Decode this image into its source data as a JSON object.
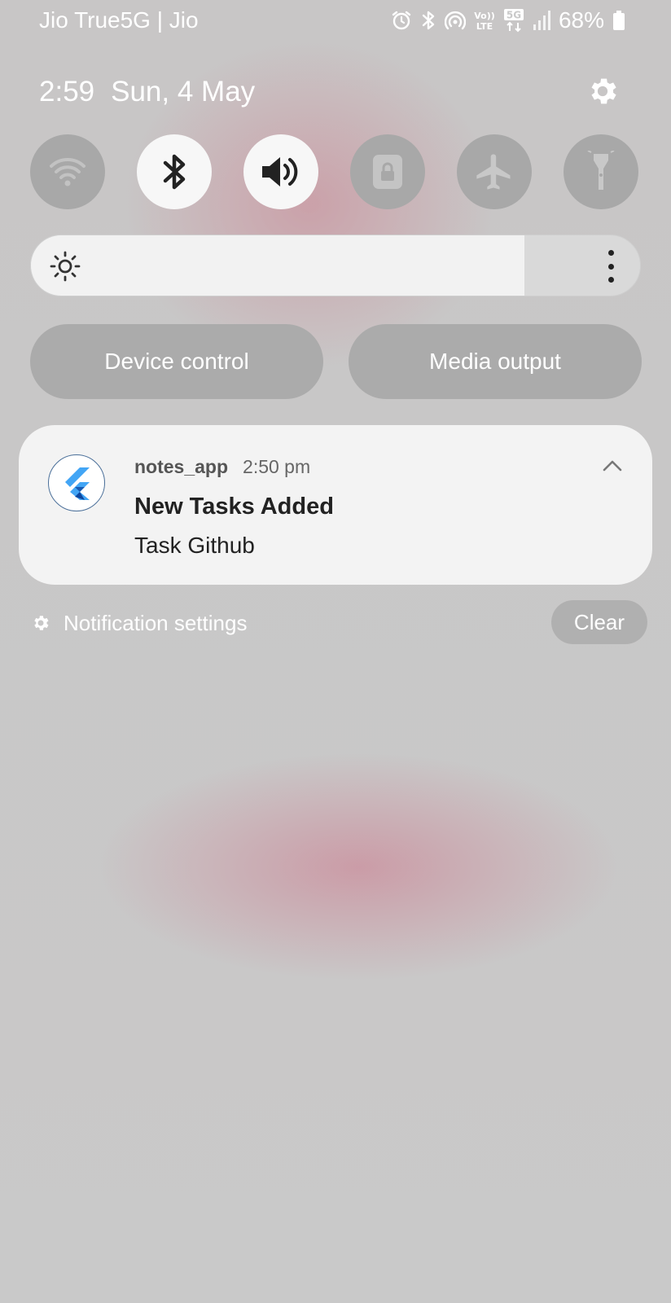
{
  "status_bar": {
    "carrier": "Jio True5G | Jio",
    "battery_percent": "68%",
    "icons": [
      "alarm-icon",
      "bluetooth-icon",
      "hotspot-icon",
      "volte-icon",
      "5g-icon",
      "signal-icon",
      "battery-icon"
    ],
    "volte_top": "Vo))",
    "volte_bottom": "LTE",
    "network_type": "5G"
  },
  "header": {
    "time": "2:59",
    "date": "Sun, 4 May",
    "settings_icon": "gear-icon"
  },
  "quick_tiles": [
    {
      "name": "wifi",
      "icon": "wifi-icon",
      "active": false
    },
    {
      "name": "bluetooth",
      "icon": "bluetooth-icon",
      "active": true
    },
    {
      "name": "sound",
      "icon": "volume-icon",
      "active": true
    },
    {
      "name": "rotation-lock",
      "icon": "lock-icon",
      "active": false
    },
    {
      "name": "airplane",
      "icon": "airplane-icon",
      "active": false
    },
    {
      "name": "flashlight",
      "icon": "flashlight-icon",
      "active": false
    }
  ],
  "brightness": {
    "level_percent": 81,
    "icon": "sun-icon",
    "more_icon": "more-vertical-icon"
  },
  "buttons": {
    "device_control": "Device control",
    "media_output": "Media output"
  },
  "notification": {
    "app_name": "notes_app",
    "time": "2:50 pm",
    "title": "New Tasks Added",
    "body": "Task Github",
    "app_icon": "flutter-icon"
  },
  "footer": {
    "notification_settings": "Notification settings",
    "clear": "Clear"
  },
  "colors": {
    "background": "#c9c9c9",
    "tile_on": "#f7f7f7",
    "tile_off": "#a8a8a8",
    "card": "#f3f3f3",
    "accent_glow": "#cd788c",
    "flutter_blue": "#42a5f5",
    "flutter_dark": "#0d47a1"
  }
}
